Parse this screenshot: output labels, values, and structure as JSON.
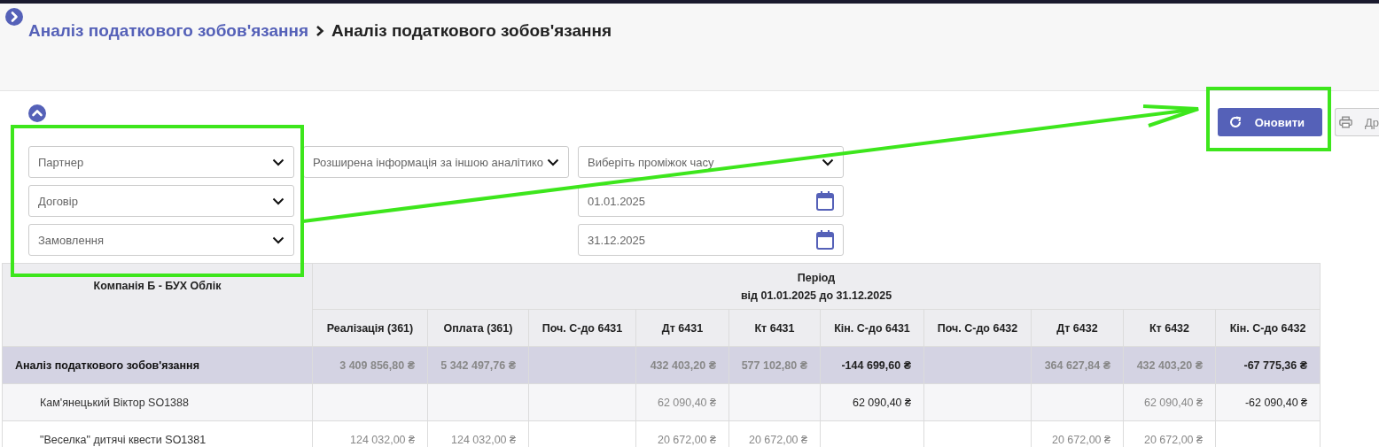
{
  "breadcrumb": [
    {
      "label": "Аналіз податкового зобов'язання",
      "kind": "link"
    },
    {
      "label": "Аналіз податкового зобов'язання",
      "kind": "current"
    }
  ],
  "toolbar": {
    "refresh_button": "Оновити",
    "print_button": "Др"
  },
  "filters": [
    {
      "placeholder": "Партнер",
      "kind": "select"
    },
    {
      "placeholder": "Розширена інформація за іншою аналітико",
      "kind": "select"
    },
    {
      "placeholder": "Виберіть проміжок часу",
      "kind": "select"
    },
    {
      "placeholder": "Договір",
      "kind": "select"
    },
    {
      "kind": "empty"
    },
    {
      "value": "01.01.2025",
      "kind": "date"
    },
    {
      "placeholder": "Замовлення",
      "kind": "select"
    },
    {
      "kind": "empty"
    },
    {
      "value": "31.12.2025",
      "kind": "date"
    }
  ],
  "table": {
    "corner": "Компанія Б - БУХ Облік",
    "period_title": "Період",
    "period_range": "від 01.01.2025 до 31.12.2025",
    "columns": [
      "Реалізація (361)",
      "Оплата (361)",
      "Поч. С-до 6431",
      "Дт 6431",
      "Кт 6431",
      "Кін. С-до 6431",
      "Поч. С-до 6432",
      "Дт 6432",
      "Кт 6432",
      "Кін. С-до 6432"
    ],
    "rows": [
      {
        "label": "Аналіз податкового зобов'язання",
        "cells": [
          {
            "text": "3 409 856,80 ₴",
            "kind": "turnover"
          },
          {
            "text": "5 342 497,76 ₴",
            "kind": "turnover"
          },
          {},
          {
            "text": "432 403,20 ₴",
            "kind": "turnover"
          },
          {
            "text": "577 102,80 ₴",
            "kind": "turnover"
          },
          {
            "text": "-144 699,60 ₴",
            "kind": "balance"
          },
          {},
          {
            "text": "364 627,84 ₴",
            "kind": "turnover"
          },
          {
            "text": "432 403,20 ₴",
            "kind": "turnover"
          },
          {
            "text": "-67 775,36 ₴",
            "kind": "balance"
          }
        ],
        "children": [
          {
            "label": "Кам'янецький Віктор SO1388",
            "cells": [
              {},
              {},
              {},
              {
                "text": "62 090,40 ₴",
                "kind": "turnover"
              },
              {},
              {
                "text": "62 090,40 ₴",
                "kind": "balance"
              },
              {},
              {},
              {
                "text": "62 090,40 ₴",
                "kind": "turnover"
              },
              {
                "text": "-62 090,40 ₴",
                "kind": "balance"
              }
            ]
          },
          {
            "label": "\"Веселка\" дитячі квести SO1381",
            "cells": [
              {
                "text": "124 032,00 ₴",
                "kind": "turnover"
              },
              {
                "text": "124 032,00 ₴",
                "kind": "turnover"
              },
              {},
              {
                "text": "20 672,00 ₴",
                "kind": "turnover"
              },
              {
                "text": "20 672,00 ₴",
                "kind": "turnover"
              },
              {},
              {},
              {
                "text": "20 672,00 ₴",
                "kind": "turnover"
              },
              {
                "text": "20 672,00 ₴",
                "kind": "turnover"
              },
              {}
            ]
          }
        ]
      }
    ]
  }
}
